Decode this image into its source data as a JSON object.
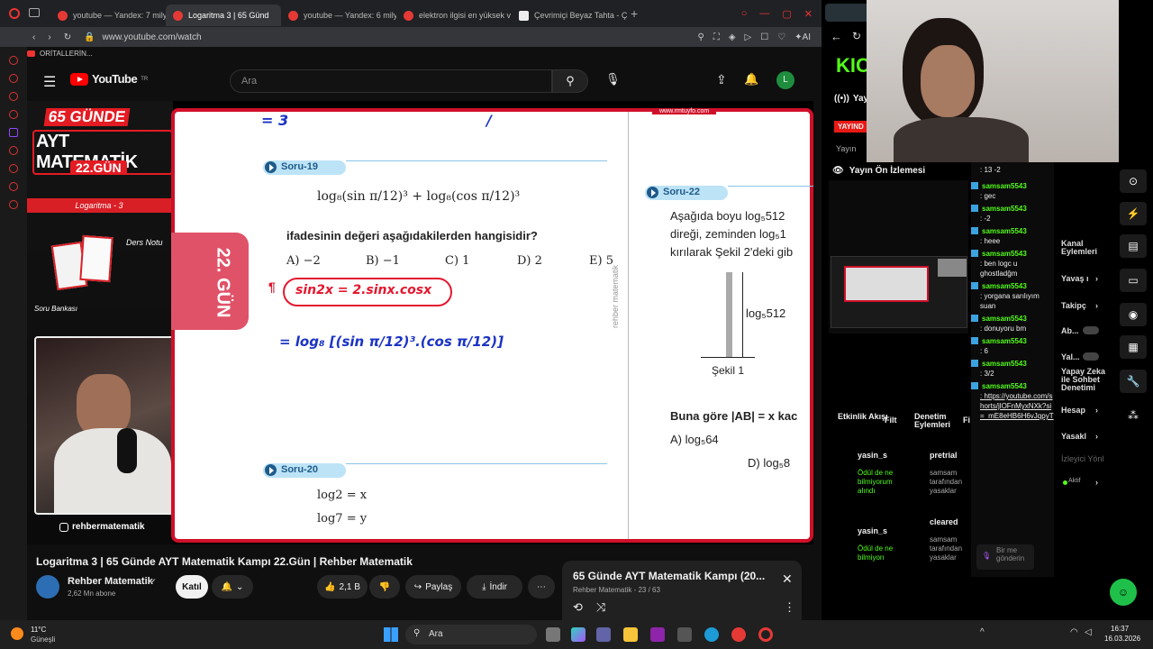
{
  "browser": {
    "tabs": [
      {
        "label": "youtube — Yandex: 7 milyo",
        "active": false
      },
      {
        "label": "Logaritma 3 | 65 Günd",
        "active": true
      },
      {
        "label": "youtube — Yandex: 6 milyo",
        "active": false
      },
      {
        "label": "elektron ilgisi en yüksek v",
        "active": false
      },
      {
        "label": "Çevrimiçi Beyaz Tahta - Ç",
        "active": false
      }
    ],
    "url": "www.youtube.com/watch",
    "bookmark": "ORİTALLERİN..."
  },
  "youtube": {
    "logo": "YouTube",
    "region": "TR",
    "search_placeholder": "Ara",
    "avatar_letter": "L"
  },
  "video_overlay": {
    "days": "65 GÜNDE",
    "course": "AYT MATEMATİK",
    "day": "22.GÜN",
    "topic": "Logaritma - 3",
    "ders_notu": "Ders Notu",
    "soru_bankasi": "Soru Bankası",
    "instagram": "rehbermatematik",
    "badge": "22. GÜN",
    "website": "www.rmtuyfo.com"
  },
  "paper": {
    "top_scribble": "= 3",
    "q19_label": "Soru-19",
    "q19_expr": "log₈(sin π/12)³ + log₈(cos π/12)³",
    "q19_text": "ifadesinin değeri aşağıdakilerden hangisidir?",
    "q19_options": [
      "A) −2",
      "B) −1",
      "C) 1",
      "D) 2",
      "E) 5"
    ],
    "hand1": "sin2x = 2.sinx.cosx",
    "hand2": "= log₈ [(sin π/12)³.(cos π/12)]",
    "q20_label": "Soru-20",
    "q20_line1": "log2 = x",
    "q20_line2": "log7 = y",
    "q22_label": "Soru-22",
    "q22_text1": "Aşağıda boyu log₅512",
    "q22_text2": "direği, zeminden log₅1",
    "q22_text3": "kırılarak Şekil 2'deki gib",
    "fig_label": "log₅512",
    "fig_caption": "Şekil 1",
    "q22_ask": "Buna göre |AB| = x kac",
    "q22_optA": "A) log₅64",
    "q22_optD": "D) log₅8",
    "watermark": "rehber matematik"
  },
  "video_info": {
    "title": "Logaritma 3 | 65 Günde AYT Matematik Kampı 22.Gün | Rehber Matematik",
    "channel": "Rehber Matematik",
    "subs": "2,62 Mn abone",
    "join": "Katıl",
    "likes": "2,1 B",
    "share": "Paylaş",
    "download": "İndir"
  },
  "playlist": {
    "title": "65 Günde AYT Matematik Kampı (20...",
    "sub": "Rehber Matematik - 23 / 63"
  },
  "kick": {
    "logo": "KIC",
    "stream_label": "Yayın",
    "live": "YAYIND",
    "yayin2": "Yayın",
    "preview_title": "Yayın Ön İzlemesi",
    "activity": "Etkinlik Akışı",
    "filter": "Filt",
    "mod_actions": "Denetim Eylemleri",
    "f2": "Fi",
    "activity_user1": "yasin_s",
    "activity_user2": "yasin_s",
    "activity_note": "Ödül de ne bilmiyorum alındı",
    "activity_note2": "Ödül de ne bilmiyorı",
    "mod1": "pretrial",
    "mod2": "cleared",
    "mod_note": "samsam tarafından yasaklar",
    "mod_note2": "samsam tarafından yasaklar"
  },
  "chat": {
    "top": ": 13 -2",
    "messages": [
      {
        "user": "samsam5543",
        "text": ": gec"
      },
      {
        "user": "samsam5543",
        "text": ": -2"
      },
      {
        "user": "samsam5543",
        "text": ": heee"
      },
      {
        "user": "samsam5543",
        "text": ": ben logc u ghostladğm"
      },
      {
        "user": "samsam5543",
        "text": ": yorgana sarılıyım suan"
      },
      {
        "user": "samsam5543",
        "text": ": donuyoru bm"
      },
      {
        "user": "samsam5543",
        "text": ": 6"
      },
      {
        "user": "samsam5543",
        "text": ": 3/2"
      },
      {
        "user": "samsam5543",
        "text": ": https://youtube.com/shorts/jlOFnMyxNXk?si=_mE8eHB6H6vJqpyT"
      }
    ],
    "input_placeholder": "Bir me gönderin"
  },
  "side_menu": [
    {
      "label": "Kanal Eylemleri"
    },
    {
      "label": "Yavaş ı"
    },
    {
      "label": "Takipç"
    },
    {
      "label": "Ab..."
    },
    {
      "label": "Yal..."
    },
    {
      "label": "Yapay Zeka ile Sohbet Denetimi"
    },
    {
      "label": "Hesap"
    },
    {
      "label": "Yasakl"
    },
    {
      "label": "İzleyici Yönl"
    },
    {
      "label": "Aktif"
    }
  ],
  "taskbar": {
    "temp": "11°C",
    "weather": "Güneşli",
    "search": "Ara",
    "time": "16:37",
    "date": "16.03.2026"
  }
}
